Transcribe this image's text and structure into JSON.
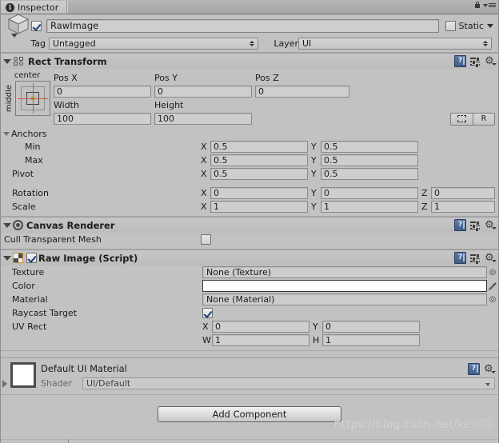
{
  "window": {
    "tab_label": "Inspector",
    "tab_icon": "info-icon",
    "lock_icon": "lock-icon",
    "menu_icon": "hamburger-menu-icon"
  },
  "gameobject": {
    "icon": "cube-icon",
    "enabled": true,
    "name": "RawImage",
    "static_label": "Static",
    "static_checked": false,
    "tag_label": "Tag",
    "tag_value": "Untagged",
    "layer_label": "Layer",
    "layer_value": "UI"
  },
  "components": [
    {
      "title": "Rect Transform",
      "icon": "rect-transform-icon",
      "anchor_preset": {
        "top_label": "center",
        "left_label": "middle"
      },
      "pos_labels": [
        "Pos X",
        "Pos Y",
        "Pos Z"
      ],
      "pos_values": [
        "0",
        "0",
        "0"
      ],
      "size_labels": [
        "Width",
        "Height"
      ],
      "size_values": [
        "100",
        "100"
      ],
      "blueprint_button": "blueprint-mode-icon",
      "raw_button": "R",
      "anchors_label": "Anchors",
      "rows": [
        {
          "label": "Min",
          "axes": [
            "X",
            "Y"
          ],
          "values": [
            "0.5",
            "0.5"
          ]
        },
        {
          "label": "Max",
          "axes": [
            "X",
            "Y"
          ],
          "values": [
            "0.5",
            "0.5"
          ]
        },
        {
          "label": "Pivot",
          "axes": [
            "X",
            "Y"
          ],
          "values": [
            "0.5",
            "0.5"
          ]
        },
        {
          "label": "Rotation",
          "axes": [
            "X",
            "Y",
            "Z"
          ],
          "values": [
            "0",
            "0",
            "0"
          ]
        },
        {
          "label": "Scale",
          "axes": [
            "X",
            "Y",
            "Z"
          ],
          "values": [
            "1",
            "1",
            "1"
          ]
        }
      ]
    },
    {
      "title": "Canvas Renderer",
      "icon": "canvas-renderer-icon",
      "cull_label": "Cull Transparent Mesh",
      "cull_checked": false
    },
    {
      "title": "Raw Image (Script)",
      "icon": "raw-image-script-icon",
      "enabled": true,
      "texture_label": "Texture",
      "texture_value": "None (Texture)",
      "color_label": "Color",
      "color_value": "#FFFFFF",
      "material_label": "Material",
      "material_value": "None (Material)",
      "raycast_label": "Raycast Target",
      "raycast_checked": true,
      "uvrect_label": "UV Rect",
      "uvrect_rows": [
        {
          "axes": [
            "X",
            "Y"
          ],
          "values": [
            "0",
            "0"
          ]
        },
        {
          "axes": [
            "W",
            "H"
          ],
          "values": [
            "1",
            "1"
          ]
        }
      ]
    }
  ],
  "material_block": {
    "title": "Default UI Material",
    "shader_label": "Shader",
    "shader_value": "UI/Default",
    "thumb_color": "#FFFFFF"
  },
  "footer": {
    "add_component_label": "Add Component",
    "watermark": "https://blog.csdn.net/ke",
    "watermark_suffix": "博客"
  },
  "icons": {
    "help": "?",
    "preset": "preset-icon",
    "gear": "⚙",
    "object_picker": "⦿",
    "eyedropper": "eyedropper-icon"
  },
  "colors": {
    "background": "#c2c2c2",
    "field": "#cecece",
    "accent_red": "#d94f4f",
    "pivot": "#b08c12",
    "script_border": "#c98a28"
  }
}
